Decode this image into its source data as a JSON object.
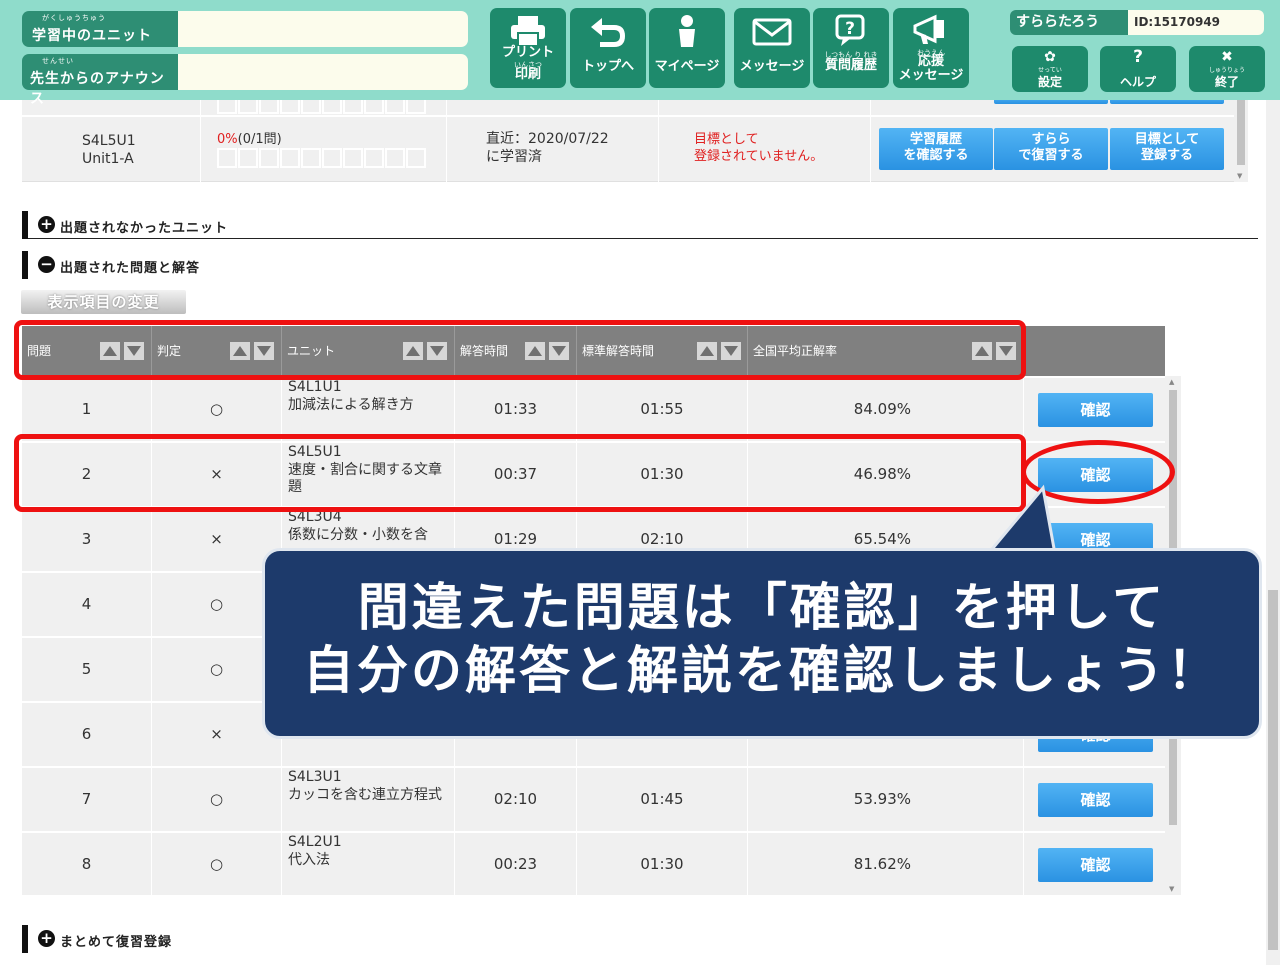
{
  "header": {
    "learning_unit": {
      "ruby": "がくしゅうちゅう",
      "label": "学習中のユニット",
      "value": ""
    },
    "announcement": {
      "ruby": "せんせい",
      "label": "先生からのアナウンス",
      "value": ""
    },
    "toolbar": [
      {
        "label": "プリント",
        "ruby": "いんさつ",
        "label2": "印刷",
        "icon": "printer-icon"
      },
      {
        "label": "トップへ",
        "icon": "back-arrow-icon"
      },
      {
        "label": "マイページ",
        "icon": "person-icon"
      },
      {
        "label": "メッセージ",
        "icon": "envelope-icon"
      },
      {
        "ruby": "しつもん り れき",
        "label": "質問履歴",
        "icon": "question-bubble-icon"
      },
      {
        "ruby": "おうえん",
        "label": "応援",
        "label2": "メッセージ",
        "icon": "megaphone-icon"
      }
    ],
    "user_name": "すららたろう",
    "user_id": "ID:15170949",
    "side_buttons": [
      {
        "ruby": "せってい",
        "label": "設定",
        "icon": "gear-icon",
        "glyph": "✿"
      },
      {
        "label": "ヘルプ",
        "icon": "help-icon",
        "glyph": "?"
      },
      {
        "ruby": "しゅうりょう",
        "label": "終了",
        "icon": "close-icon",
        "glyph": "✖"
      }
    ]
  },
  "summary_row": {
    "unit_code": "S4L5U1",
    "unit_sub": "Unit1-A",
    "rate": "0%",
    "rate_detail": "(0/1問)",
    "recent_line1": "直近：2020/07/22",
    "recent_line2": "に学習済",
    "goal_line1": "目標として",
    "goal_line2": "登録されていません。",
    "buttons": [
      {
        "l1": "学習履歴",
        "l2": "を確認する"
      },
      {
        "l1": "すらら",
        "l2": "で復習する"
      },
      {
        "l1": "目標として",
        "l2": "登録する"
      }
    ]
  },
  "sections": {
    "not_asked": "出題されなかったユニット",
    "asked": "出題された問題と解答",
    "bulk_review": "まとめて復習登録"
  },
  "display_change": "表示項目の変更",
  "table": {
    "headers": [
      "問題",
      "判定",
      "ユニット",
      "解答時間",
      "標準解答時間",
      "全国平均正解率"
    ],
    "confirm_label": "確認",
    "rows": [
      {
        "no": "1",
        "judge": "○",
        "unit_code": "S4L1U1",
        "unit_name": "加減法による解き方",
        "time": "01:33",
        "std_time": "01:55",
        "rate": "84.09%"
      },
      {
        "no": "2",
        "judge": "×",
        "unit_code": "S4L5U1",
        "unit_name": "速度・割合に関する文章題",
        "time": "00:37",
        "std_time": "01:30",
        "rate": "46.98%"
      },
      {
        "no": "3",
        "judge": "×",
        "unit_code": "S4L3U4",
        "unit_name": "係数に分数・小数を含",
        "time": "01:29",
        "std_time": "02:10",
        "rate": "65.54%"
      },
      {
        "no": "4",
        "judge": "○",
        "unit_code": "",
        "unit_name": "",
        "time": "",
        "std_time": "",
        "rate": ""
      },
      {
        "no": "5",
        "judge": "○",
        "unit_code": "",
        "unit_name": "",
        "time": "",
        "std_time": "",
        "rate": ""
      },
      {
        "no": "6",
        "judge": "×",
        "unit_code": "",
        "unit_name": "",
        "time": "",
        "std_time": "",
        "rate": ""
      },
      {
        "no": "7",
        "judge": "○",
        "unit_code": "S4L3U1",
        "unit_name": "カッコを含む連立方程式",
        "time": "02:10",
        "std_time": "01:45",
        "rate": "53.93%"
      },
      {
        "no": "8",
        "judge": "○",
        "unit_code": "S4L2U1",
        "unit_name": "代入法",
        "time": "00:23",
        "std_time": "01:30",
        "rate": "81.62%"
      }
    ]
  },
  "callout": {
    "line1": "間違えた問題は「確認」を押して",
    "line2": "自分の解答と解説を確認しましょう！"
  },
  "colors": {
    "header_bg": "#8fdccb",
    "header_button": "#1e8a6c",
    "confirm_button": "#2a92e2",
    "callout_bg": "#1d3a6b",
    "highlight": "#ee1111",
    "error_text": "#e02020"
  }
}
